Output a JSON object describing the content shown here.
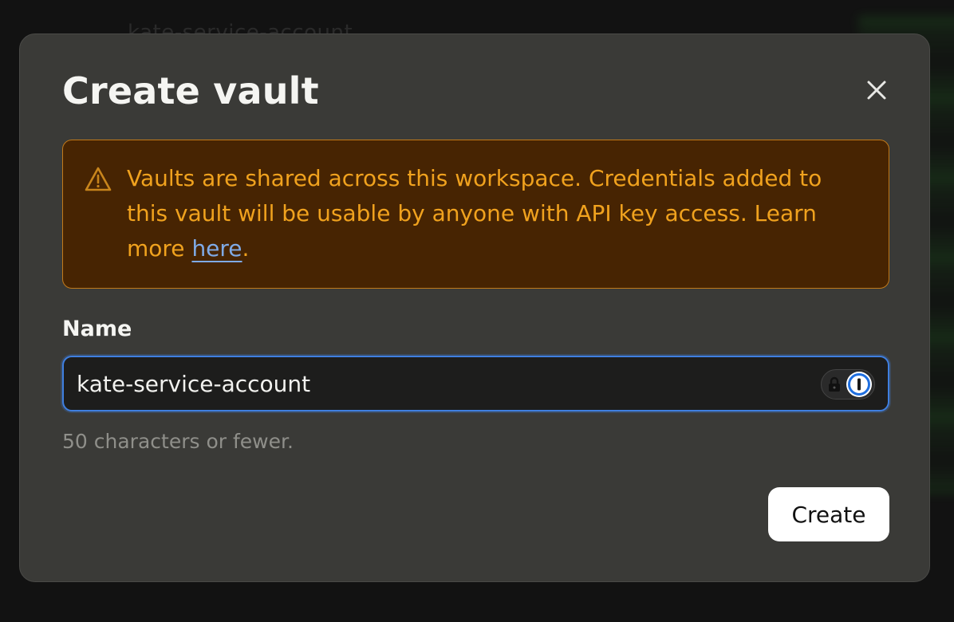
{
  "background": {
    "ghost_text": "kate-service-account"
  },
  "modal": {
    "title": "Create vault",
    "close_icon": "close-icon",
    "warning": {
      "icon": "warning-triangle-icon",
      "text_before_link": "Vaults are shared across this workspace. Credentials added to this vault will be usable by anyone with API key access. Learn more ",
      "link_text": "here",
      "text_after_link": ".",
      "text_color": "#f0a21e",
      "background_color": "#472402",
      "border_color": "#c27a1a",
      "link_color": "#7faae6"
    },
    "name_field": {
      "label": "Name",
      "value": "kate-service-account",
      "helper_text": "50 characters or fewer.",
      "focus_color": "#3f7fe0",
      "password_manager_icon": "password-manager-icon"
    },
    "create_button_label": "Create"
  }
}
